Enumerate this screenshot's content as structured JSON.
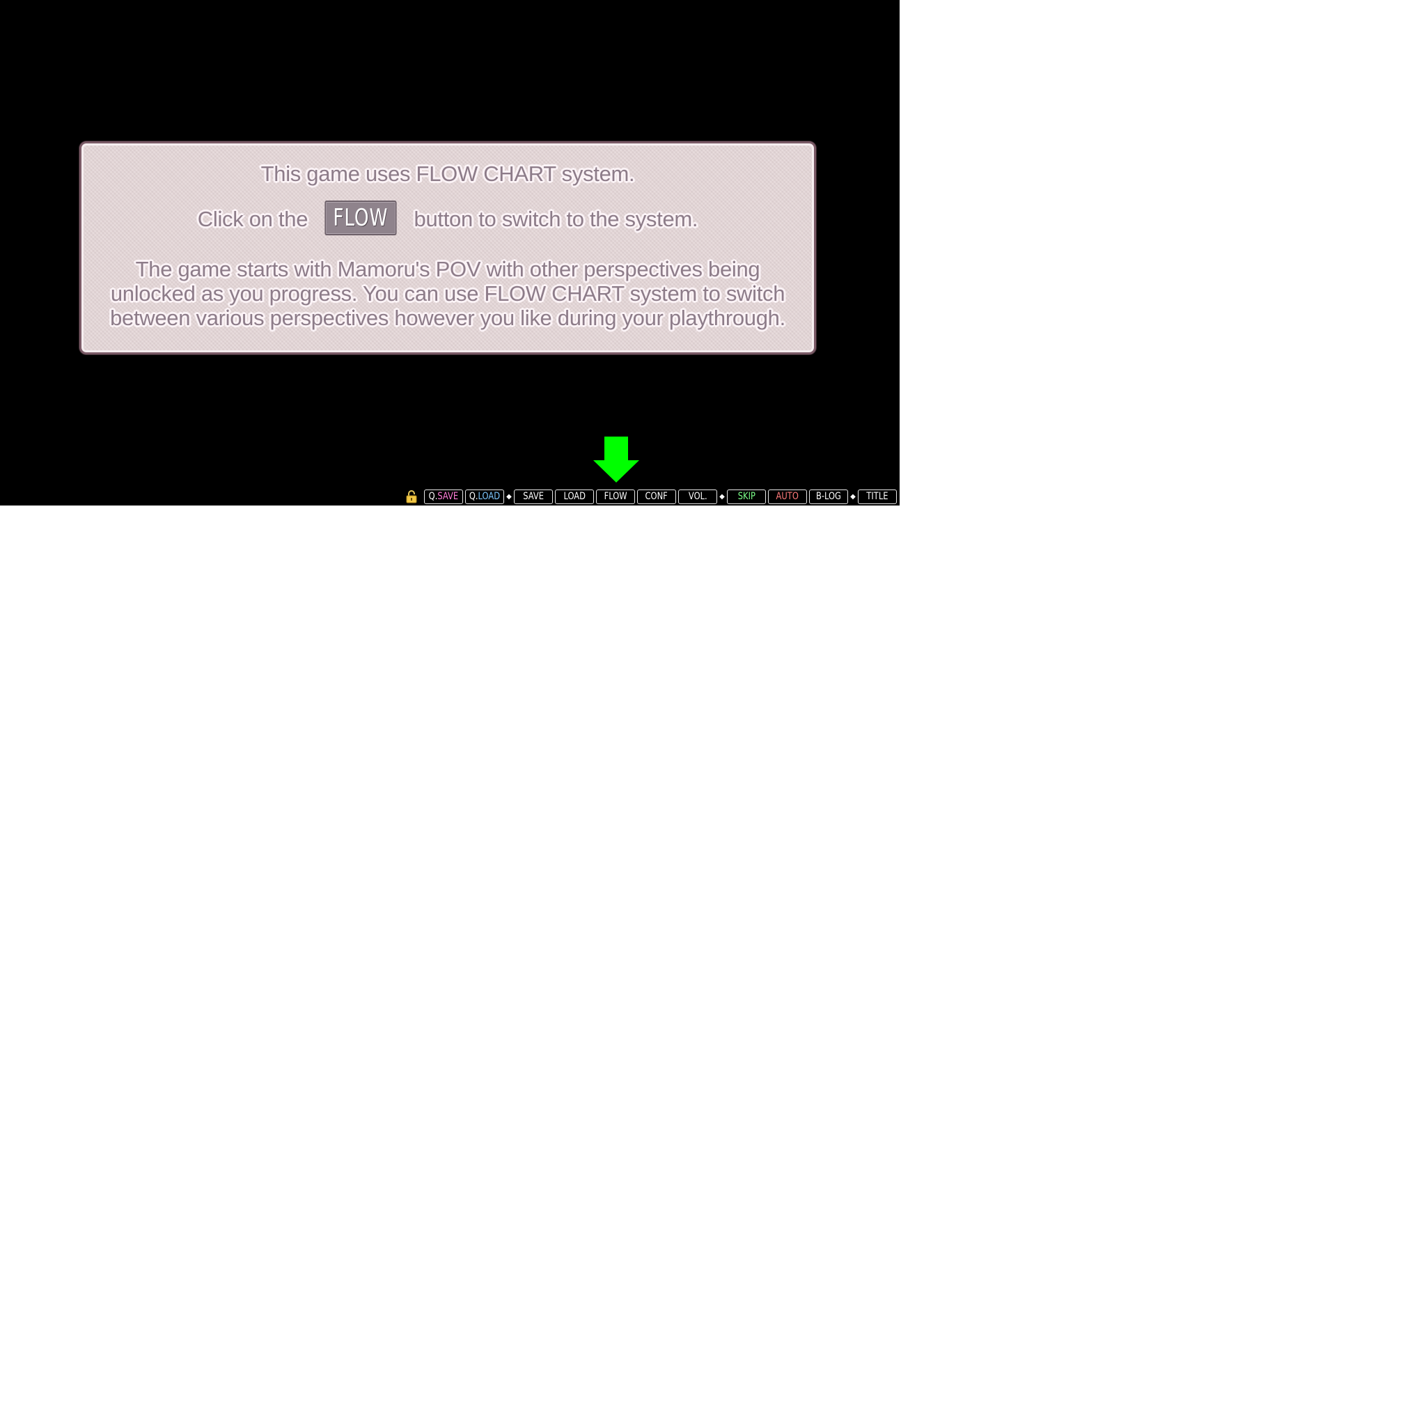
{
  "info_panel": {
    "line1": "This game uses FLOW CHART system.",
    "line2_before": "Click on the",
    "line2_button": "FLOW",
    "line2_after": "button to switch to the system.",
    "paragraph": "The game starts with Mamoru's POV with other perspectives being\nunlocked as you progress. You can use FLOW CHART system to switch\nbetween various perspectives however you like during your playthrough."
  },
  "pointer": {
    "icon": "arrow-down-icon",
    "color": "#00ff00"
  },
  "toolbar": {
    "lock_icon": "lock-icon",
    "separator": "◆",
    "qsave": {
      "prefix": "Q.",
      "label": "SAVE",
      "color": "#ff7ed8"
    },
    "qload": {
      "prefix": "Q.",
      "label": "LOAD",
      "color": "#7ec8ff"
    },
    "save": "SAVE",
    "load": "LOAD",
    "flow": "FLOW",
    "conf": "CONF",
    "vol": "VOL.",
    "skip": {
      "label": "SKIP",
      "color": "#7dff8a"
    },
    "auto": {
      "label": "AUTO",
      "color": "#ff7a7a"
    },
    "blog": "B-LOG",
    "title": "TITLE"
  }
}
